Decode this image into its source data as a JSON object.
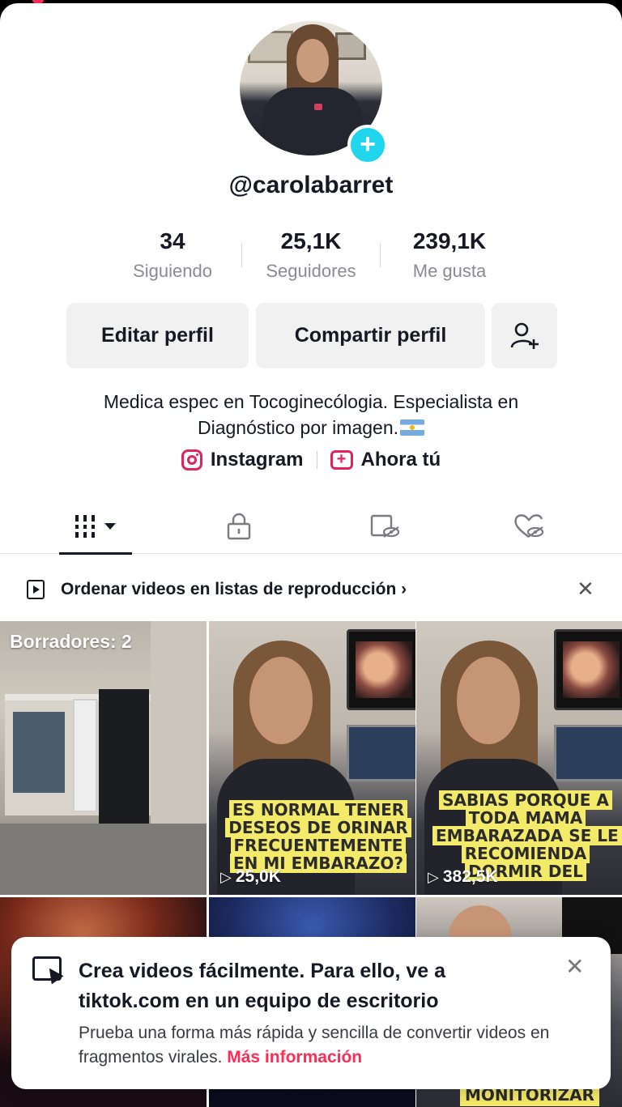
{
  "profile": {
    "username": "@carolabarret",
    "stats": [
      {
        "value": "34",
        "label": "Siguiendo"
      },
      {
        "value": "25,1K",
        "label": "Seguidores"
      },
      {
        "value": "239,1K",
        "label": "Me gusta"
      }
    ],
    "buttons": {
      "edit": "Editar perfil",
      "share": "Compartir perfil"
    },
    "bio_line1": "Medica espec en Tocoginecólogia. Especialista en",
    "bio_line2": "Diagnóstico por imagen.",
    "links": {
      "instagram": "Instagram",
      "ahora": "Ahora tú"
    }
  },
  "playlist_banner": {
    "text": "Ordenar videos en listas de reproducción"
  },
  "grid": {
    "drafts_label": "Borradores: 2",
    "videos": [
      {
        "caption": "ES NORMAL TENER DESEOS DE ORINAR FRECUENTEMENTE EN MI EMBARAZO?",
        "views": "25,0K"
      },
      {
        "caption": "SABIAS PORQUE A TODA MAMA EMBARAZADA SE LE RECOMIENDA DORMIR DEL",
        "views": "382,5K"
      },
      {
        "caption": "MONITORIZAR",
        "views": ""
      }
    ]
  },
  "toast": {
    "title": "Crea videos fácilmente. Para ello, ve a tiktok.com en un equipo de escritorio",
    "body": "Prueba una forma más rápida y sencilla de convertir videos en fragmentos virales.",
    "more": "Más información"
  },
  "icons": {
    "avatar_plus": "plus-icon",
    "add_friend": "person-add-icon",
    "videos_tab": "grid-icon",
    "private_tab": "lock-icon",
    "reposts_tab": "repost-icon",
    "liked_tab": "heart-icon"
  },
  "colors": {
    "accent_cyan": "#20d5ec",
    "accent_red": "#fe2c55",
    "caption_yellow": "#f4ea6a"
  }
}
